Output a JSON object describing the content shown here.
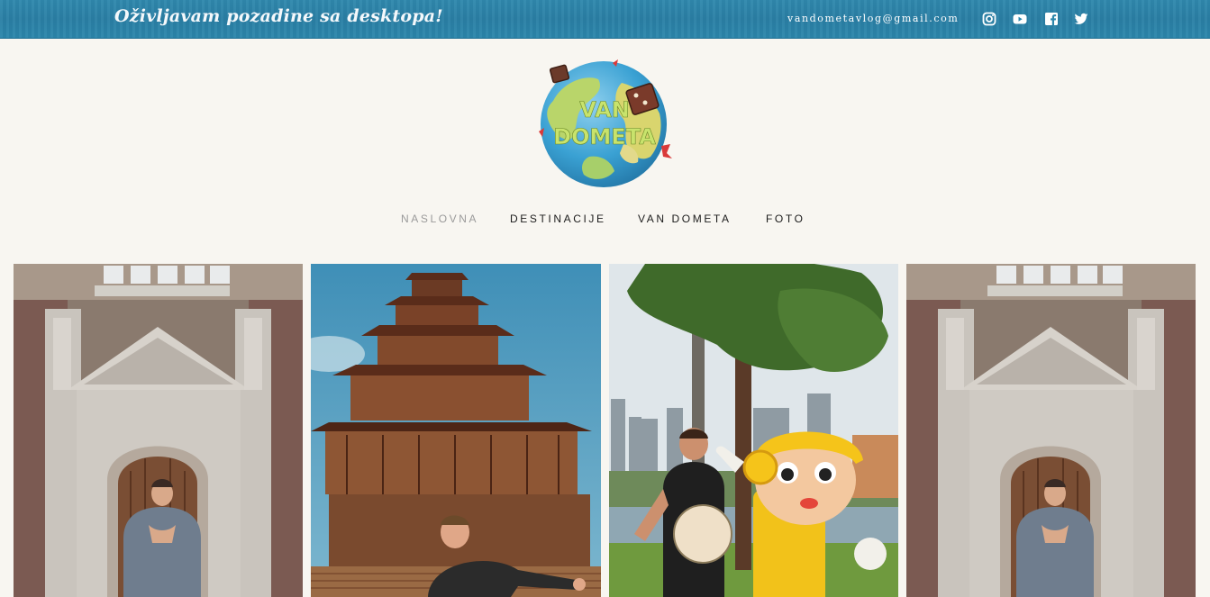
{
  "header": {
    "tagline": "Oživljavam pozadine sa desktopa!",
    "email": "vandometavlog@gmail.com",
    "social_icons": [
      "instagram-icon",
      "youtube-icon",
      "facebook-icon",
      "twitter-icon"
    ]
  },
  "logo": {
    "text": "VAN DOMETA"
  },
  "nav": {
    "items": [
      {
        "label": "NASLOVNA",
        "active": true
      },
      {
        "label": "DESTINACIJE",
        "active": false
      },
      {
        "label": "VAN DOMETA",
        "active": false
      },
      {
        "label": "FOTO",
        "active": false
      }
    ]
  },
  "gallery": {
    "photos": [
      {
        "subject": "ornate-building-facade"
      },
      {
        "subject": "pagoda-temple"
      },
      {
        "subject": "city-park-mascot-statue"
      },
      {
        "subject": "ornate-building-facade"
      }
    ]
  },
  "colors": {
    "topbar": "#2b86ab",
    "background": "#f8f6f1",
    "nav_active": "#9a9a9a",
    "nav_text": "#1c1c1c"
  }
}
